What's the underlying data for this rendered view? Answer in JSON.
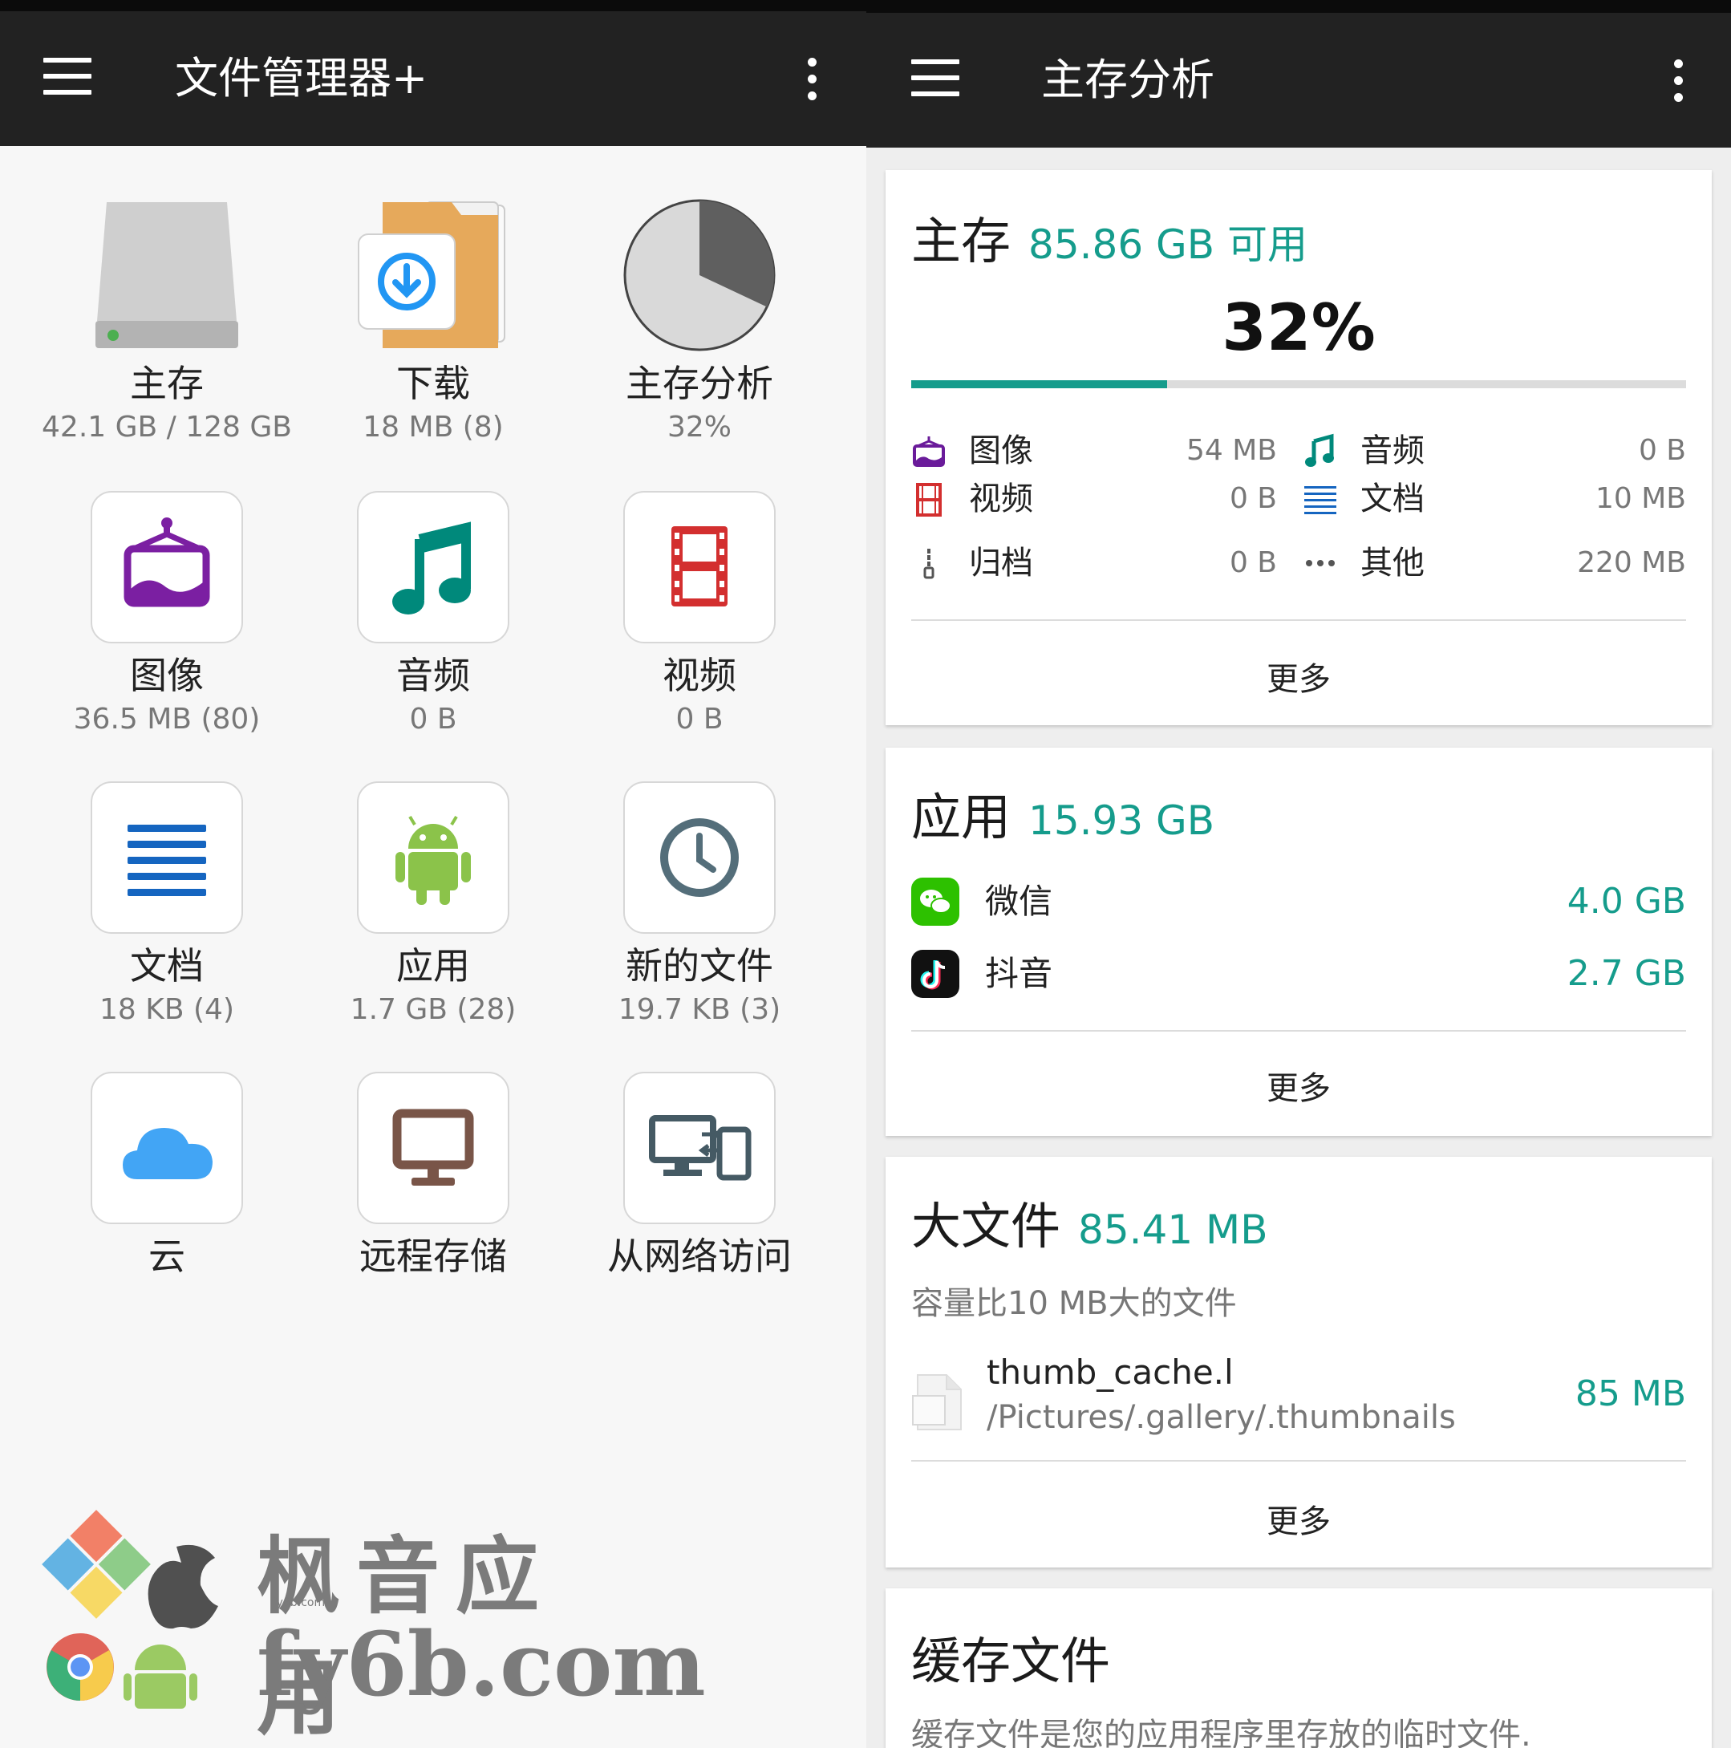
{
  "left": {
    "title": "文件管理器+",
    "tiles": [
      {
        "label": "主存",
        "sub": "42.1 GB / 128 GB"
      },
      {
        "label": "下载",
        "sub": "18 MB (8)"
      },
      {
        "label": "主存分析",
        "sub": "32%"
      },
      {
        "label": "图像",
        "sub": "36.5 MB (80)"
      },
      {
        "label": "音频",
        "sub": "0 B"
      },
      {
        "label": "视频",
        "sub": "0 B"
      },
      {
        "label": "文档",
        "sub": "18 KB (4)"
      },
      {
        "label": "应用",
        "sub": "1.7 GB (28)"
      },
      {
        "label": "新的文件",
        "sub": "19.7 KB (3)"
      },
      {
        "label": "云",
        "sub": ""
      },
      {
        "label": "远程存储",
        "sub": ""
      },
      {
        "label": "从网络访问",
        "sub": ""
      }
    ],
    "storage_used_fraction": 0.32
  },
  "right": {
    "title": "主存分析",
    "main_card": {
      "title": "主存",
      "amount": "85.86 GB 可用",
      "percent": "32%",
      "progress_fraction": 0.33,
      "stats": [
        {
          "name": "图像",
          "value": "54 MB",
          "icon": "image-icon",
          "color": "#6a1b9a"
        },
        {
          "name": "音频",
          "value": "0 B",
          "icon": "music-note-icon",
          "color": "#00897b"
        },
        {
          "name": "视频",
          "value": "0 B",
          "icon": "film-icon",
          "color": "#d32f2f"
        },
        {
          "name": "文档",
          "value": "10 MB",
          "icon": "document-lines-icon",
          "color": "#1565c0"
        },
        {
          "name": "归档",
          "value": "0 B",
          "icon": "zip-icon",
          "color": "#555555"
        },
        {
          "name": "其他",
          "value": "220 MB",
          "icon": "more-dots-icon",
          "color": "#555555"
        }
      ],
      "more": "更多"
    },
    "apps_card": {
      "title": "应用",
      "amount": "15.93 GB",
      "apps": [
        {
          "name": "微信",
          "value": "4.0 GB"
        },
        {
          "name": "抖音",
          "value": "2.7 GB"
        }
      ],
      "more": "更多"
    },
    "big_files_card": {
      "title": "大文件",
      "amount": "85.41 MB",
      "desc": "容量比10 MB大的文件",
      "file": {
        "name": "thumb_cache.l",
        "path": "/Pictures/.gallery/.thumbnails",
        "size": "85 MB"
      },
      "more": "更多"
    },
    "cache_card": {
      "title": "缓存文件",
      "desc": "缓存文件是您的应用程序里存放的临时文件."
    }
  },
  "watermark": {
    "line1": "枫音应用",
    "line2": "fy6b.com",
    "small": "fy6b.com"
  },
  "colors": {
    "accent": "#159c8c",
    "appbar": "#222222"
  }
}
